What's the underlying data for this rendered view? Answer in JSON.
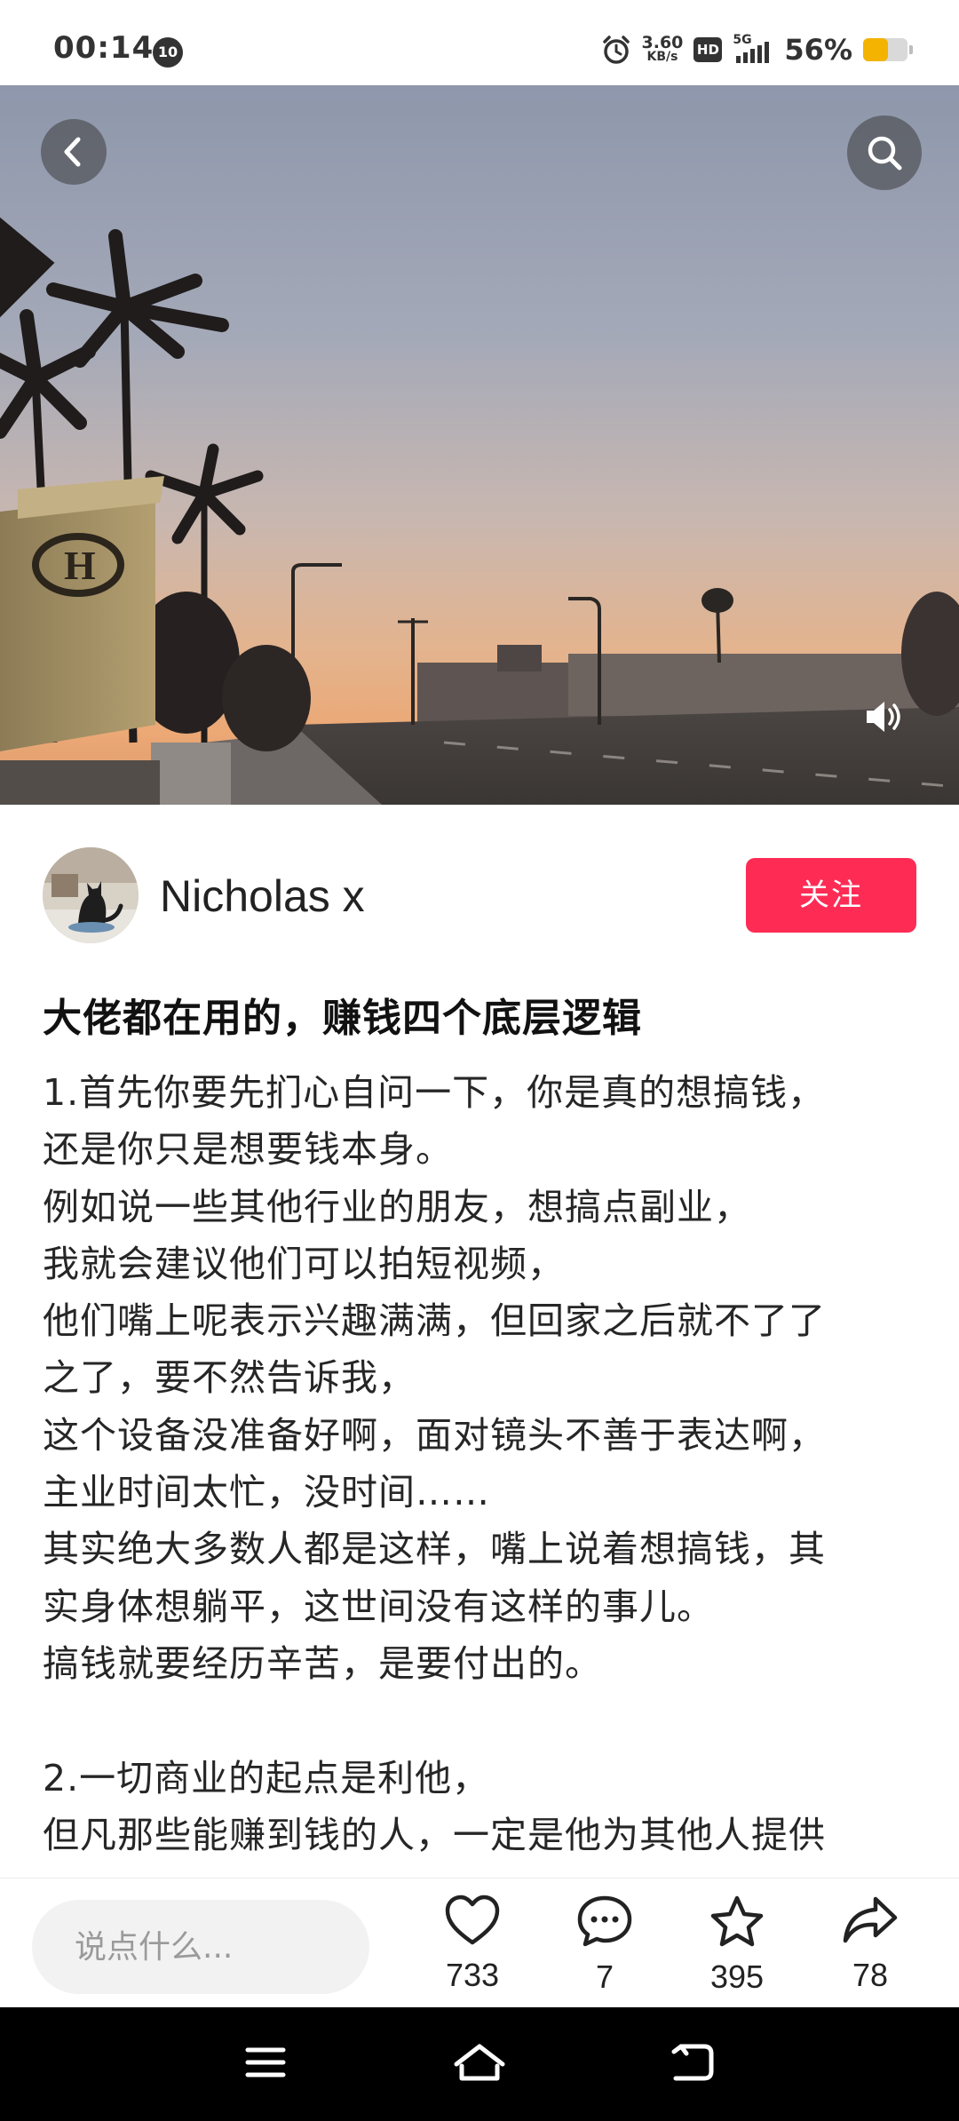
{
  "status_bar": {
    "time": "00:14",
    "notification_badge": "10",
    "net_speed_value": "3.60",
    "net_speed_unit": "KB/s",
    "hd_label": "HD",
    "network_type": "5G",
    "battery_percent_text": "56%",
    "battery_level": 0.56,
    "battery_color": "#f4b300"
  },
  "hero": {
    "icons": [
      "back-icon",
      "search-icon",
      "speaker-icon"
    ]
  },
  "author": {
    "name": "Nicholas x",
    "follow_label": "关注",
    "follow_color": "#fe2c55"
  },
  "post": {
    "title": "大佬都在用的，赚钱四个底层逻辑",
    "lines": [
      "1.首先你要先扪心自问一下，你是真的想搞钱，",
      "还是你只是想要钱本身。",
      "例如说一些其他行业的朋友，想搞点副业，",
      "我就会建议他们可以拍短视频，",
      "他们嘴上呢表示兴趣满满，但回家之后就不了了",
      "之了，要不然告诉我，",
      "这个设备没准备好啊，面对镜头不善于表达啊，",
      "主业时间太忙，没时间……",
      "其实绝大多数人都是这样，嘴上说着想搞钱，其",
      "实身体想躺平，这世间没有这样的事儿。",
      "搞钱就要经历辛苦，是要付出的。",
      "",
      "2.一切商业的起点是利他，",
      "但凡那些能赚到钱的人，一定是他为其他人提供"
    ]
  },
  "action_bar": {
    "comment_placeholder": "说点什么...",
    "likes": "733",
    "comments": "7",
    "favorites": "395",
    "shares": "78"
  },
  "nav_bar": {
    "icons": [
      "menu-icon",
      "home-icon",
      "back-nav-icon"
    ]
  }
}
